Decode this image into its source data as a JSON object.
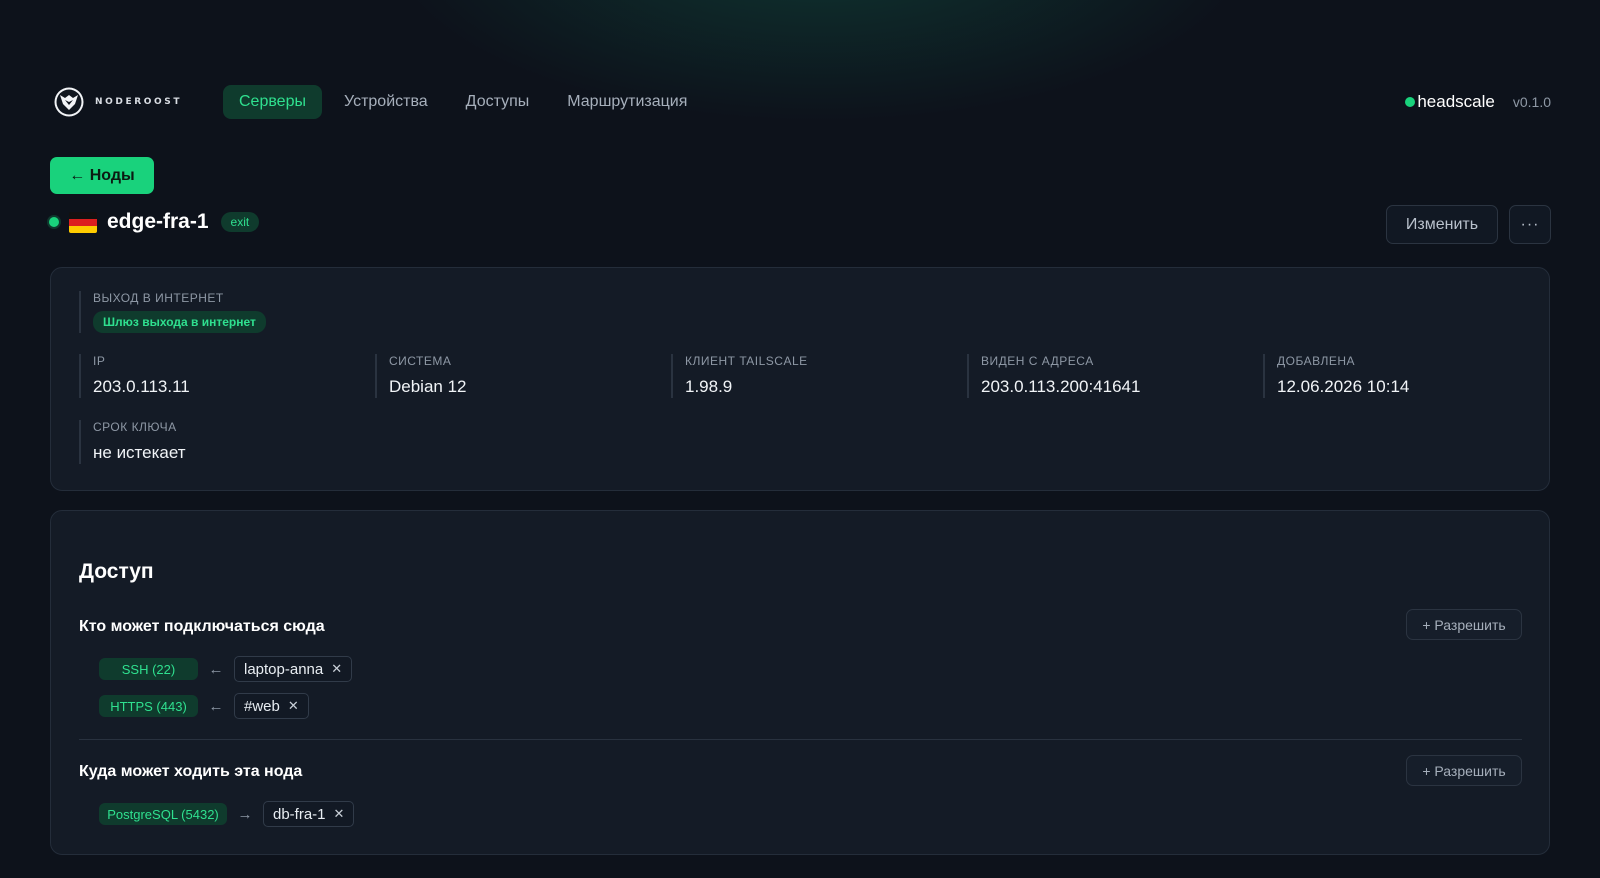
{
  "brand": {
    "name": "NODEROOST"
  },
  "nav": {
    "items": [
      {
        "label": "Серверы",
        "active": true
      },
      {
        "label": "Устройства",
        "active": false
      },
      {
        "label": "Доступы",
        "active": false
      },
      {
        "label": "Маршрутизация",
        "active": false
      }
    ]
  },
  "header": {
    "backend": "headscale",
    "version": "v0.1.0",
    "backend_status_color": "#19d27c"
  },
  "back_button": {
    "label": "← Ноды"
  },
  "node": {
    "name": "edge-fra-1",
    "badge": "exit",
    "online": true,
    "country_flag": "germany-flag-icon"
  },
  "actions": {
    "edit_label": "Изменить",
    "more_label": "···"
  },
  "info": {
    "exit": {
      "label": "ВЫХОД В ИНТЕРНЕТ",
      "value": "Шлюз выхода в интернет"
    },
    "ip": {
      "label": "IP",
      "value": "203.0.113.11"
    },
    "os": {
      "label": "СИСТЕМА",
      "value": "Debian 12"
    },
    "client": {
      "label": "КЛИЕНТ TAILSCALE",
      "value": "1.98.9"
    },
    "seen_from": {
      "label": "ВИДЕН С АДРЕСА",
      "value": "203.0.113.200:41641"
    },
    "added": {
      "label": "ДОБАВЛЕНА",
      "value": "12.06.2026 10:14"
    },
    "key_expiry": {
      "label": "СРОК КЛЮЧА",
      "value": "не истекает"
    }
  },
  "access": {
    "title": "Доступ",
    "incoming": {
      "title": "Кто может подключаться сюда",
      "allow_label": "+ Разрешить",
      "rules": [
        {
          "port": "SSH (22)",
          "arrow": "←",
          "target": "laptop-anna"
        },
        {
          "port": "HTTPS (443)",
          "arrow": "←",
          "target": "#web"
        }
      ]
    },
    "outgoing": {
      "title": "Куда может ходить эта нода",
      "allow_label": "+ Разрешить",
      "rules": [
        {
          "port": "PostgreSQL (5432)",
          "arrow": "→",
          "target": "db-fra-1"
        }
      ]
    },
    "remove_glyph": "✕"
  },
  "colors": {
    "accent": "#19d27c",
    "accent_text": "#2fe08f",
    "accent_bg": "#0f3b2d",
    "background": "#0d121b",
    "card": "#141b26"
  }
}
